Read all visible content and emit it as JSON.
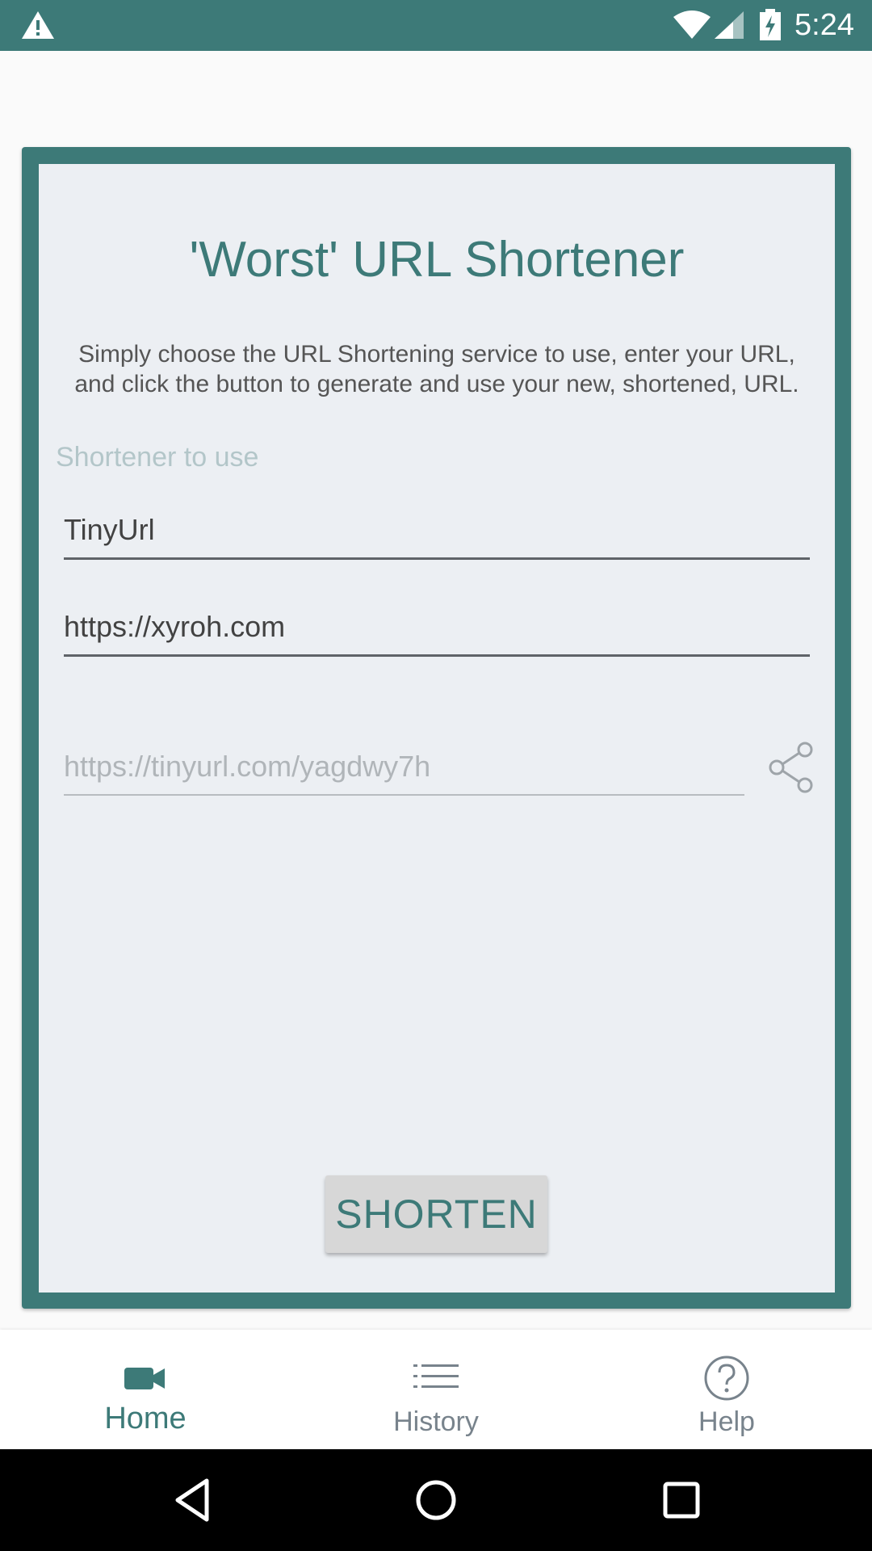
{
  "status_bar": {
    "time": "5:24",
    "icons": [
      "warning-icon",
      "wifi-icon",
      "signal-icon",
      "battery-charging-icon"
    ]
  },
  "main": {
    "title": "'Worst' URL Shortener",
    "description": "Simply choose the URL Shortening service to use, enter your URL, and click the button to generate and use your new, shortened, URL.",
    "shortener_label": "Shortener to use",
    "shortener_value": "TinyUrl",
    "url_value": "https://xyroh.com",
    "result_value": "https://tinyurl.com/yagdwy7h",
    "share_icon": "share-icon",
    "shorten_label": "SHORTEN"
  },
  "bottom_nav": {
    "items": [
      {
        "label": "Home",
        "icon": "video-camera-icon",
        "active": true
      },
      {
        "label": "History",
        "icon": "list-icon",
        "active": false
      },
      {
        "label": "Help",
        "icon": "help-circle-icon",
        "active": false
      }
    ]
  },
  "colors": {
    "accent": "#3d7a78",
    "card_bg": "#eceff3",
    "inactive_nav": "#78838c"
  }
}
